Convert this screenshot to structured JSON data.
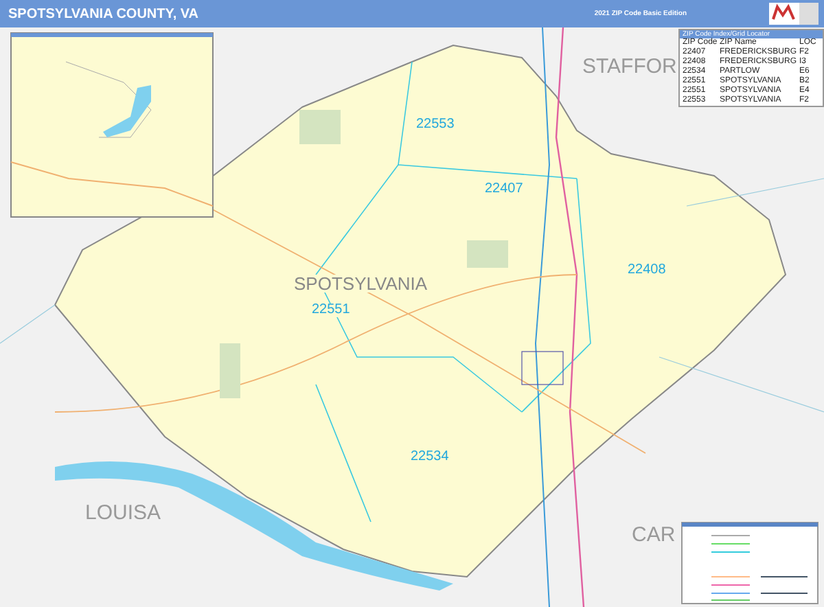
{
  "header": {
    "title": "SPOTSYLVANIA COUNTY, VA",
    "edition": "2021 ZIP Code Basic Edition"
  },
  "zip_table": {
    "title": "ZIP Code Index/Grid Locator",
    "columns": [
      "ZIP Code",
      "ZIP Name",
      "LOC"
    ],
    "rows": [
      [
        "22407",
        "FREDERICKSBURG",
        "F2"
      ],
      [
        "22408",
        "FREDERICKSBURG",
        "I3"
      ],
      [
        "22534",
        "PARTLOW",
        "E6"
      ],
      [
        "22551",
        "SPOTSYLVANIA",
        "B2"
      ],
      [
        "22551",
        "SPOTSYLVANIA",
        "E4"
      ],
      [
        "22553",
        "SPOTSYLVANIA",
        "F2"
      ]
    ]
  },
  "map": {
    "labels": [
      {
        "text": "STAFFOR",
        "kind": "neighbor"
      },
      {
        "text": "22553",
        "kind": "zip"
      },
      {
        "text": "22407",
        "kind": "zip"
      },
      {
        "text": "22408",
        "kind": "zip"
      },
      {
        "text": "SPOTSYLVANIA",
        "kind": "county"
      },
      {
        "text": "22551",
        "kind": "zip"
      },
      {
        "text": "22534",
        "kind": "zip"
      },
      {
        "text": "LOUISA",
        "kind": "neighbor"
      },
      {
        "text": "CAR",
        "kind": "neighbor"
      }
    ]
  }
}
